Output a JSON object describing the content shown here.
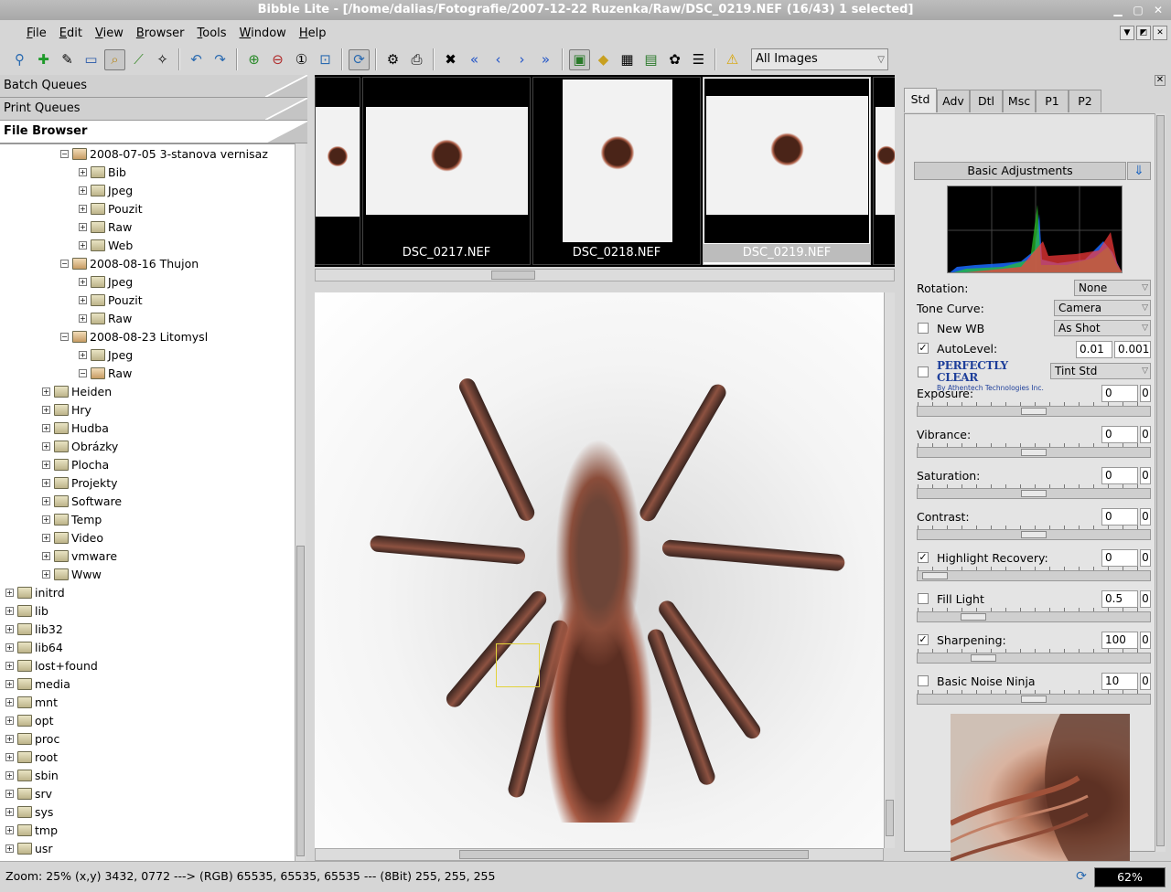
{
  "window": {
    "title": "Bibble Lite - [/home/dalias/Fotografie/2007-12-22 Ruzenka/Raw/DSC_0219.NEF (16/43) 1 selected]"
  },
  "menu": [
    "File",
    "Edit",
    "View",
    "Browser",
    "Tools",
    "Window",
    "Help"
  ],
  "toolbar": {
    "filter_value": "All Images",
    "icons": [
      "search-icon",
      "add-icon",
      "eyedropper-icon",
      "crop-icon",
      "zoom-select-icon",
      "level-icon",
      "magic-wand-icon",
      "undo-icon",
      "redo-icon",
      "zoom-in-icon",
      "zoom-out-icon",
      "zoom-actual-icon",
      "zoom-fit-icon",
      "refresh-icon",
      "settings-icon",
      "print-icon",
      "delete-icon",
      "first-icon",
      "previous-icon",
      "next-icon",
      "last-icon",
      "image-view-icon",
      "tag-icon",
      "grid-icon",
      "thumbnail-icon",
      "palette-icon",
      "document-icon",
      "warning-icon"
    ]
  },
  "left_panel": {
    "tabs": [
      "Batch Queues",
      "Print Queues",
      "File Browser"
    ],
    "active_tab": "File Browser",
    "tree": [
      {
        "label": "2008-07-05 3-stanova vernisaz",
        "level": 3,
        "open": true
      },
      {
        "label": "Bib",
        "level": 4,
        "open": false
      },
      {
        "label": "Jpeg",
        "level": 4,
        "open": false
      },
      {
        "label": "Pouzit",
        "level": 4,
        "open": false
      },
      {
        "label": "Raw",
        "level": 4,
        "open": false
      },
      {
        "label": "Web",
        "level": 4,
        "open": false
      },
      {
        "label": "2008-08-16 Thujon",
        "level": 3,
        "open": true
      },
      {
        "label": "Jpeg",
        "level": 4,
        "open": false
      },
      {
        "label": "Pouzit",
        "level": 4,
        "open": false
      },
      {
        "label": "Raw",
        "level": 4,
        "open": false
      },
      {
        "label": "2008-08-23 Litomysl",
        "level": 3,
        "open": true
      },
      {
        "label": "Jpeg",
        "level": 4,
        "open": false
      },
      {
        "label": "Raw",
        "level": 4,
        "open": true
      },
      {
        "label": "Heiden",
        "level": 2,
        "open": false
      },
      {
        "label": "Hry",
        "level": 2,
        "open": false
      },
      {
        "label": "Hudba",
        "level": 2,
        "open": false
      },
      {
        "label": "Obrázky",
        "level": 2,
        "open": false
      },
      {
        "label": "Plocha",
        "level": 2,
        "open": false
      },
      {
        "label": "Projekty",
        "level": 2,
        "open": false
      },
      {
        "label": "Software",
        "level": 2,
        "open": false
      },
      {
        "label": "Temp",
        "level": 2,
        "open": false
      },
      {
        "label": "Video",
        "level": 2,
        "open": false
      },
      {
        "label": "vmware",
        "level": 2,
        "open": false
      },
      {
        "label": "Www",
        "level": 2,
        "open": false
      },
      {
        "label": "initrd",
        "level": 0,
        "open": false
      },
      {
        "label": "lib",
        "level": 0,
        "open": false
      },
      {
        "label": "lib32",
        "level": 0,
        "open": false
      },
      {
        "label": "lib64",
        "level": 0,
        "open": false
      },
      {
        "label": "lost+found",
        "level": 0,
        "open": false
      },
      {
        "label": "media",
        "level": 0,
        "open": false
      },
      {
        "label": "mnt",
        "level": 0,
        "open": false
      },
      {
        "label": "opt",
        "level": 0,
        "open": false
      },
      {
        "label": "proc",
        "level": 0,
        "open": false
      },
      {
        "label": "root",
        "level": 0,
        "open": false
      },
      {
        "label": "sbin",
        "level": 0,
        "open": false
      },
      {
        "label": "srv",
        "level": 0,
        "open": false
      },
      {
        "label": "sys",
        "level": 0,
        "open": false
      },
      {
        "label": "tmp",
        "level": 0,
        "open": false
      },
      {
        "label": "usr",
        "level": 0,
        "open": false
      }
    ]
  },
  "thumbnails": [
    {
      "caption": "",
      "selected": false
    },
    {
      "caption": "DSC_0217.NEF",
      "selected": false
    },
    {
      "caption": "DSC_0218.NEF",
      "selected": false
    },
    {
      "caption": "DSC_0219.NEF",
      "selected": true
    },
    {
      "caption": "",
      "selected": false
    }
  ],
  "right_panel": {
    "tabs": [
      "Std",
      "Adv",
      "Dtl",
      "Msc",
      "P1",
      "P2"
    ],
    "active_tab": "Std",
    "section_title": "Basic Adjustments",
    "rotation": {
      "label": "Rotation:",
      "value": "None"
    },
    "tone_curve": {
      "label": "Tone Curve:",
      "value": "Camera"
    },
    "new_wb": {
      "label": "New WB",
      "checked": false,
      "value": "As Shot"
    },
    "autolevel": {
      "label": "AutoLevel:",
      "checked": true,
      "low": "0.01",
      "high": "0.001"
    },
    "perfectly_clear": {
      "logo": "PERFECTLY CLEAR",
      "sublogo": "By Athentech Technologies Inc.",
      "checked": false,
      "value": "Tint Std"
    },
    "sliders": [
      {
        "label": "Exposure:",
        "value": "0",
        "zero": "0",
        "checkbox": false
      },
      {
        "label": "Vibrance:",
        "value": "0",
        "zero": "0",
        "checkbox": false
      },
      {
        "label": "Saturation:",
        "value": "0",
        "zero": "0",
        "checkbox": false
      },
      {
        "label": "Contrast:",
        "value": "0",
        "zero": "0",
        "checkbox": false
      },
      {
        "label": "Highlight Recovery:",
        "value": "0",
        "zero": "0",
        "checkbox": true,
        "checked": true
      },
      {
        "label": "Fill Light",
        "value": "0.5",
        "zero": "0",
        "checkbox": true,
        "checked": false
      },
      {
        "label": "Sharpening:",
        "value": "100",
        "zero": "0",
        "checkbox": true,
        "checked": true
      },
      {
        "label": "Basic Noise Ninja",
        "value": "10",
        "zero": "0",
        "checkbox": true,
        "checked": false
      }
    ]
  },
  "status": {
    "text": "Zoom:  25% (x,y) 3432, 0772 ---> (RGB) 65535, 65535, 65535 ---  (8Bit) 255, 255, 255",
    "progress": "62%"
  }
}
